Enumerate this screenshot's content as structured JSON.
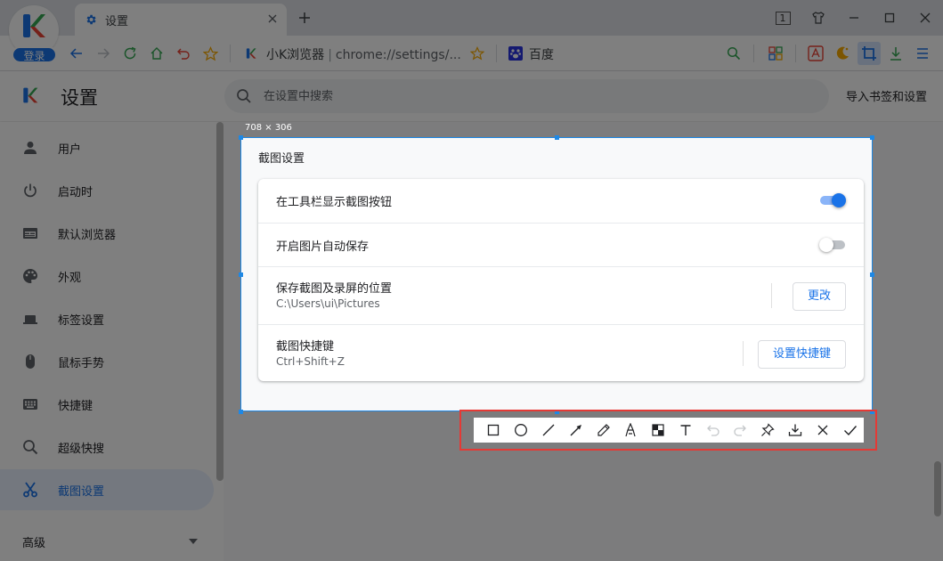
{
  "browser": {
    "login_label": "登录",
    "tab": {
      "title": "设置"
    },
    "window_badge": "1",
    "omnibox": {
      "site_name": "小K浏览器",
      "url": "chrome://settings/..."
    },
    "bookmark": {
      "label": "百度"
    }
  },
  "header": {
    "title": "设置",
    "search": {
      "placeholder": "在设置中搜索",
      "value": ""
    },
    "import_label": "导入书签和设置"
  },
  "sidebar": {
    "items": [
      {
        "label": "用户",
        "icon": "person-icon"
      },
      {
        "label": "启动时",
        "icon": "power-icon"
      },
      {
        "label": "默认浏览器",
        "icon": "browser-window-icon"
      },
      {
        "label": "外观",
        "icon": "palette-icon"
      },
      {
        "label": "标签设置",
        "icon": "tab-icon"
      },
      {
        "label": "鼠标手势",
        "icon": "mouse-icon"
      },
      {
        "label": "快捷键",
        "icon": "keyboard-icon"
      },
      {
        "label": "超级快搜",
        "icon": "search-icon"
      },
      {
        "label": "截图设置",
        "icon": "scissors-icon",
        "active": true
      }
    ],
    "advanced_label": "高级"
  },
  "selection": {
    "size_label": "708 × 306"
  },
  "screenshot_settings": {
    "section_title": "截图设置",
    "rows": [
      {
        "label": "在工具栏显示截图按钮",
        "toggle": true
      },
      {
        "label": "开启图片自动保存",
        "toggle": false
      },
      {
        "label": "保存截图及录屏的位置",
        "sub": "C:\\Users\\ui\\Pictures",
        "button": "更改"
      },
      {
        "label": "截图快捷键",
        "sub": "Ctrl+Shift+Z",
        "button": "设置快捷键"
      }
    ]
  },
  "capture_toolbar": {
    "tools": [
      "rectangle-icon",
      "ellipse-icon",
      "line-icon",
      "arrow-icon",
      "pencil-icon",
      "marker-icon",
      "mosaic-icon",
      "text-icon",
      "undo-icon",
      "redo-icon",
      "pin-icon",
      "download-icon",
      "close-icon",
      "confirm-icon"
    ]
  },
  "colors": {
    "accent": "#1a73e8",
    "highlight_border": "#e53935",
    "selection_border": "#1e88e5"
  }
}
